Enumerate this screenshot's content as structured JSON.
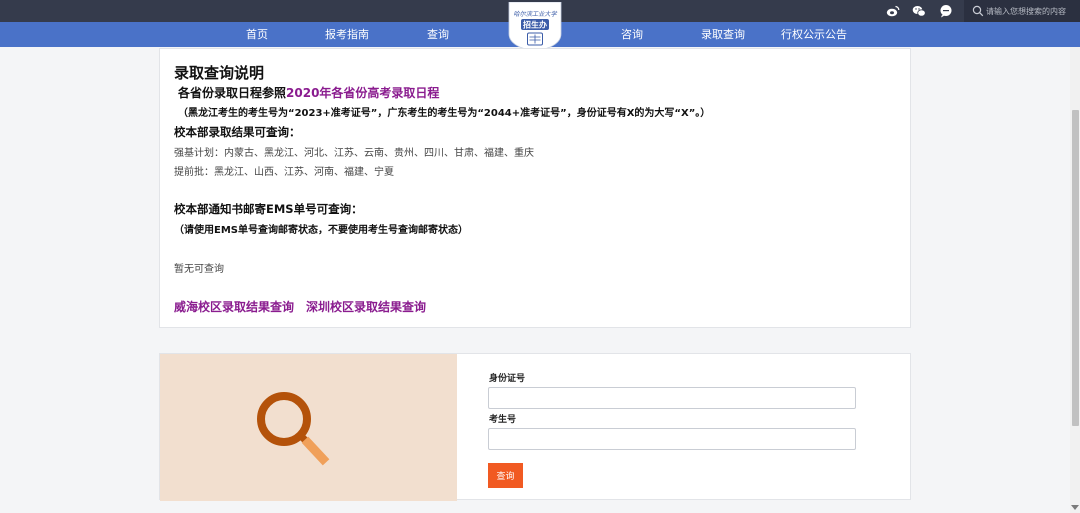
{
  "topbar": {
    "icons": [
      "weibo-icon",
      "wechat-icon",
      "chat-icon",
      "search-icon"
    ],
    "search": {
      "placeholder": "请输入您想搜索的内容",
      "value": ""
    }
  },
  "nav": {
    "items": [
      {
        "label": "首页"
      },
      {
        "label": "报考指南"
      },
      {
        "label": "查询"
      },
      {
        "label": "咨询"
      },
      {
        "label": "录取查询"
      },
      {
        "label": "行权公示公告"
      }
    ]
  },
  "logo": {
    "university_name": "哈尔滨工业大学",
    "badge_label": "招生办"
  },
  "info": {
    "title": "录取查询说明",
    "schedule_prefix": "各省份录取日程参照",
    "schedule_link": "2020年各省份高考录取日程",
    "note": "（黑龙江考生的考生号为“2023+准考证号”，广东考生的考生号为“2044+准考证号”，身份证号有X的为大写“X”。）",
    "results_heading": "校本部录取结果可查询：",
    "line_qiangji": "强基计划：内蒙古、黑龙江、河北、江苏、云南、贵州、四川、甘肃、福建、重庆",
    "line_tiqian": "提前批：黑龙江、山西、江苏、河南、福建、宁夏",
    "ems_heading": "校本部通知书邮寄EMS单号可查询：",
    "ems_note": "（请使用EMS单号查询邮寄状态，不要使用考生号查询邮寄状态）",
    "not_available": "暂无可查询",
    "weihai_link": "威海校区录取结果查询",
    "shenzhen_link": "深圳校区录取结果查询"
  },
  "query": {
    "image_icon": "magnifier-icon",
    "id_label": "身份证号",
    "id_value": "",
    "exam_label": "考生号",
    "exam_value": "",
    "submit_label": "查询"
  },
  "colors": {
    "topbar": "#353b4c",
    "nav": "#4a72c8",
    "link": "#8a1c8f",
    "button": "#f15a22",
    "magnifier": "#b4520a",
    "magnifier_handle": "#f0a05a",
    "image_bg": "#f2dfcf"
  }
}
